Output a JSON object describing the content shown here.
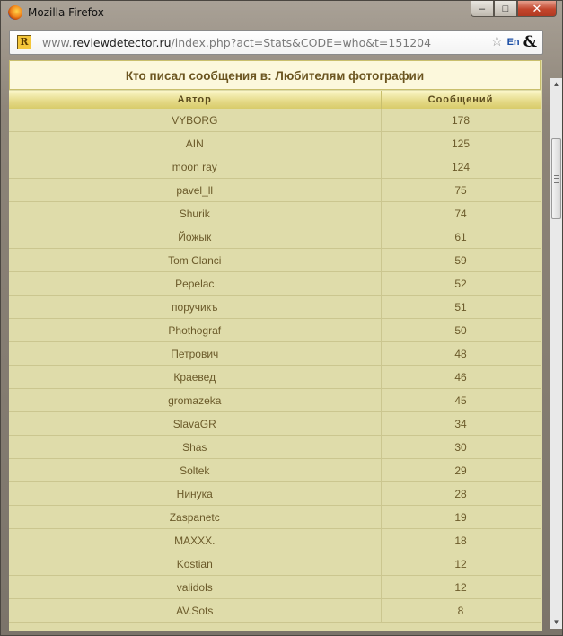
{
  "window": {
    "title": "Mozilla Firefox",
    "controls": {
      "minimize": "–",
      "maximize": "□",
      "close": "✕"
    }
  },
  "addressbar": {
    "url_prefix": "www.",
    "url_host": "reviewdetector.ru",
    "url_path": "/index.php?act=Stats&CODE=who&t=151204",
    "site_icon_letter": "R",
    "icons": [
      "bookmark-star-icon",
      "language-icon",
      "amp-icon"
    ],
    "lang_label": "En"
  },
  "page": {
    "heading": "Кто писал сообщения в: Любителям фотографии",
    "columns": [
      "Автор",
      "Сообщений"
    ],
    "rows": [
      {
        "author": "VYBORG",
        "count": "178"
      },
      {
        "author": "AIN",
        "count": "125"
      },
      {
        "author": "moon ray",
        "count": "124"
      },
      {
        "author": "pavel_ll",
        "count": "75"
      },
      {
        "author": "Shurik",
        "count": "74"
      },
      {
        "author": "Йожык",
        "count": "61"
      },
      {
        "author": "Tom Clanci",
        "count": "59"
      },
      {
        "author": "Pepelac",
        "count": "52"
      },
      {
        "author": "поручикъ",
        "count": "51"
      },
      {
        "author": "Phothograf",
        "count": "50"
      },
      {
        "author": "Петрович",
        "count": "48"
      },
      {
        "author": "Краевед",
        "count": "46"
      },
      {
        "author": "gromazeka",
        "count": "45"
      },
      {
        "author": "SlavaGR",
        "count": "34"
      },
      {
        "author": "Shas",
        "count": "30"
      },
      {
        "author": "Soltek",
        "count": "29"
      },
      {
        "author": "Нинука",
        "count": "28"
      },
      {
        "author": "Zaspanetc",
        "count": "19"
      },
      {
        "author": "MAXXX.",
        "count": "18"
      },
      {
        "author": "Kostian",
        "count": "12"
      },
      {
        "author": "validols",
        "count": "12"
      },
      {
        "author": "AV.Sots",
        "count": "8"
      }
    ]
  },
  "colors": {
    "heading_bg": "#fcf8dc",
    "table_bg": "#dfdcaa",
    "text": "#6b5a2a"
  }
}
